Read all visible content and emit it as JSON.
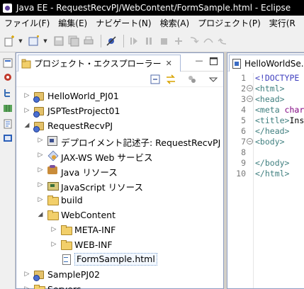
{
  "window": {
    "title": "Java EE - RequestRecvPJ/WebContent/FormSample.html - Eclipse"
  },
  "menubar": {
    "items": [
      "ファイル(F)",
      "編集(E)",
      "ナビゲート(N)",
      "検索(A)",
      "プロジェクト(P)",
      "実行(R"
    ]
  },
  "explorer": {
    "tab_title": "プロジェクト・エクスプローラー",
    "tab_close": "✕",
    "tree": [
      {
        "label": "HelloWorld_PJ01",
        "icon": "project-icon",
        "depth": 0,
        "expanded": false
      },
      {
        "label": "JSPTestProject01",
        "icon": "project-icon",
        "depth": 0,
        "expanded": false
      },
      {
        "label": "RequestRecvPJ",
        "icon": "project-icon",
        "depth": 0,
        "expanded": true
      },
      {
        "label": "デプロイメント記述子: RequestRecvPJ",
        "icon": "deployment-descriptor-icon",
        "depth": 1,
        "expanded": false
      },
      {
        "label": "JAX-WS Web サービス",
        "icon": "web-services-icon",
        "depth": 1,
        "expanded": false
      },
      {
        "label": "Java リソース",
        "icon": "java-resources-icon",
        "depth": 1,
        "expanded": false
      },
      {
        "label": "JavaScript リソース",
        "icon": "javascript-resources-icon",
        "depth": 1,
        "expanded": false
      },
      {
        "label": "build",
        "icon": "folder-icon",
        "depth": 1,
        "expanded": false
      },
      {
        "label": "WebContent",
        "icon": "folder-icon",
        "depth": 1,
        "expanded": true
      },
      {
        "label": "META-INF",
        "icon": "folder-icon",
        "depth": 2,
        "expanded": false
      },
      {
        "label": "WEB-INF",
        "icon": "folder-icon",
        "depth": 2,
        "expanded": false
      },
      {
        "label": "FormSample.html",
        "icon": "html-file-icon",
        "depth": 2,
        "leaf": true,
        "selected": true
      },
      {
        "label": "SamplePJ02",
        "icon": "project-icon",
        "depth": 0,
        "expanded": false
      },
      {
        "label": "Servers",
        "icon": "folder-icon",
        "depth": 0,
        "expanded": false
      }
    ]
  },
  "editor": {
    "tab_title": "HelloWorldSe...",
    "lines": [
      {
        "num": "1",
        "fold": false,
        "text": "<!DOCTYPE"
      },
      {
        "num": "2",
        "fold": true,
        "text": "<html>"
      },
      {
        "num": "3",
        "fold": true,
        "text": "<head>"
      },
      {
        "num": "4",
        "fold": false,
        "text": "<meta char"
      },
      {
        "num": "5",
        "fold": false,
        "text": "<title>Ins"
      },
      {
        "num": "6",
        "fold": false,
        "text": "</head>"
      },
      {
        "num": "7",
        "fold": true,
        "text": "<body>"
      },
      {
        "num": "8",
        "fold": false,
        "text": ""
      },
      {
        "num": "9",
        "fold": false,
        "text": "</body>"
      },
      {
        "num": "10",
        "fold": false,
        "text": "</html>"
      }
    ]
  }
}
